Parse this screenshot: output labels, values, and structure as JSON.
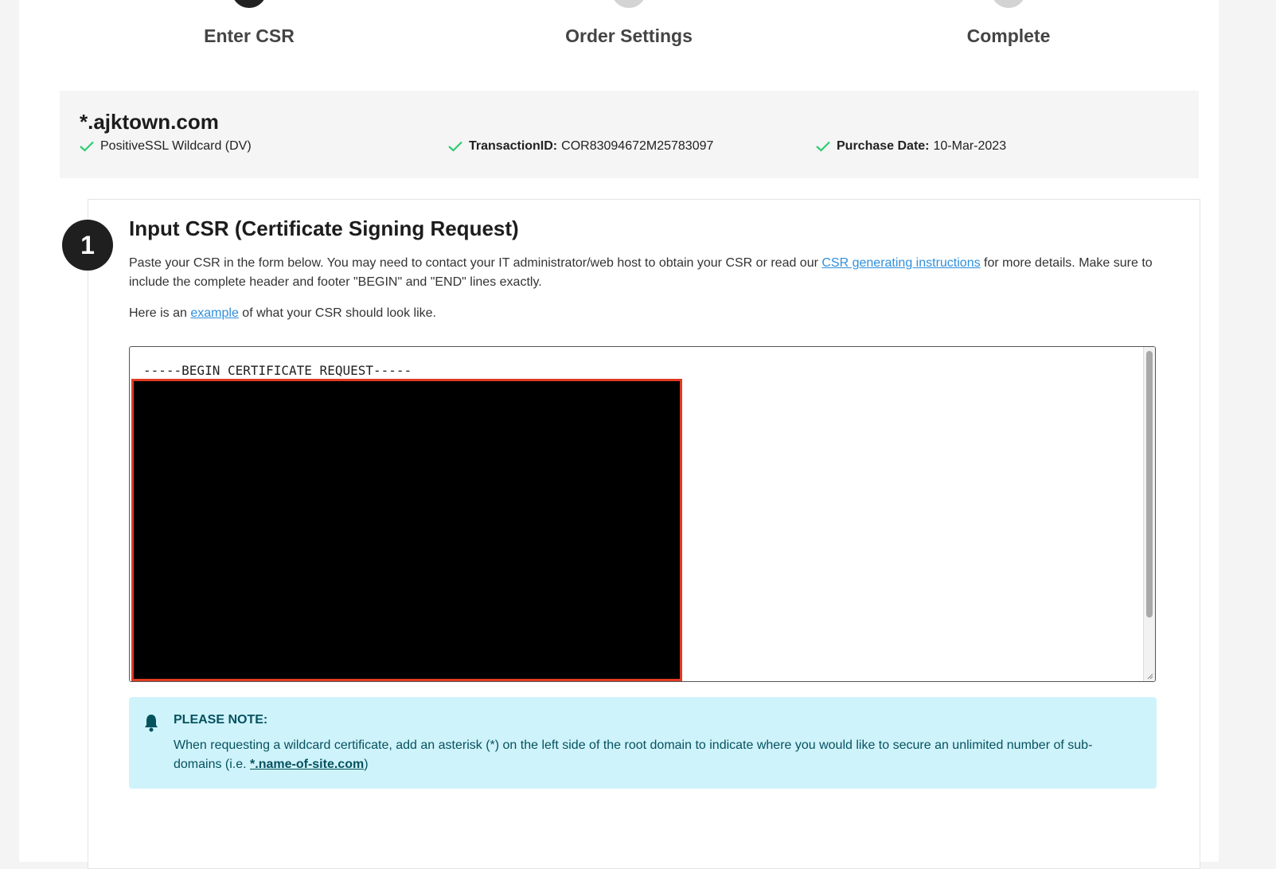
{
  "steps": [
    {
      "label": "Enter CSR",
      "state": "active"
    },
    {
      "label": "Order Settings",
      "state": "inactive"
    },
    {
      "label": "Complete",
      "state": "inactive"
    }
  ],
  "summary": {
    "domain": "*.ajktown.com",
    "product": "PositiveSSL Wildcard (DV)",
    "transaction_label": "TransactionID:",
    "transaction_value": "COR83094672M25783097",
    "purchase_label": "Purchase Date:",
    "purchase_value": "10-Mar-2023"
  },
  "section": {
    "number": "1",
    "title": "Input CSR (Certificate Signing Request)",
    "desc_before": "Paste your CSR in the form below. You may need to contact your IT administrator/web host to obtain your CSR or read our ",
    "desc_link": "CSR generating instructions",
    "desc_after": " for more details. Make sure to include the complete header and footer \"BEGIN\" and \"END\" lines exactly.",
    "example_before": "Here is an ",
    "example_link": "example",
    "example_after": " of what your CSR should look like.",
    "csr_first_line": "-----BEGIN CERTIFICATE REQUEST-----"
  },
  "note": {
    "title": "PLEASE NOTE:",
    "body_before": "When requesting a wildcard certificate, add an asterisk (*) on the left side of the root domain to indicate where you would like to secure an unlimited number of sub-domains (i.e. ",
    "body_example": "*.name-of-site.com",
    "body_after": ")"
  },
  "colors": {
    "check": "#2ecc71",
    "link": "#2f8fdc",
    "note_bg": "#cff3fb",
    "note_text": "#05525f",
    "redaction_border": "#e03a22"
  }
}
